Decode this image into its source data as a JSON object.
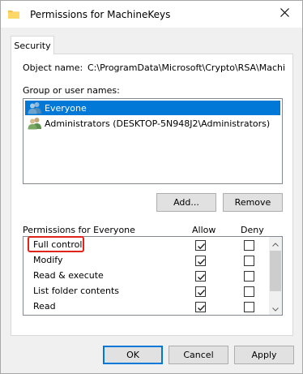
{
  "window": {
    "title": "Permissions for MachineKeys"
  },
  "tabs": [
    {
      "label": "Security"
    }
  ],
  "object": {
    "label": "Object name:",
    "value": "C:\\ProgramData\\Microsoft\\Crypto\\RSA\\MachineK"
  },
  "groups": {
    "label": "Group or user names:",
    "items": [
      {
        "name": "Everyone",
        "selected": true
      },
      {
        "name": "Administrators (DESKTOP-5N948J2\\Administrators)",
        "selected": false
      }
    ]
  },
  "group_buttons": {
    "add": "Add...",
    "remove": "Remove"
  },
  "permissions": {
    "header": "Permissions for Everyone",
    "allow_label": "Allow",
    "deny_label": "Deny",
    "rows": [
      {
        "name": "Full control",
        "allow": true,
        "deny": false
      },
      {
        "name": "Modify",
        "allow": true,
        "deny": false
      },
      {
        "name": "Read & execute",
        "allow": true,
        "deny": false
      },
      {
        "name": "List folder contents",
        "allow": true,
        "deny": false
      },
      {
        "name": "Read",
        "allow": true,
        "deny": false
      }
    ]
  },
  "dialog_buttons": {
    "ok": "OK",
    "cancel": "Cancel",
    "apply": "Apply"
  },
  "colors": {
    "selection": "#0078d7",
    "highlight": "#e2231a"
  }
}
